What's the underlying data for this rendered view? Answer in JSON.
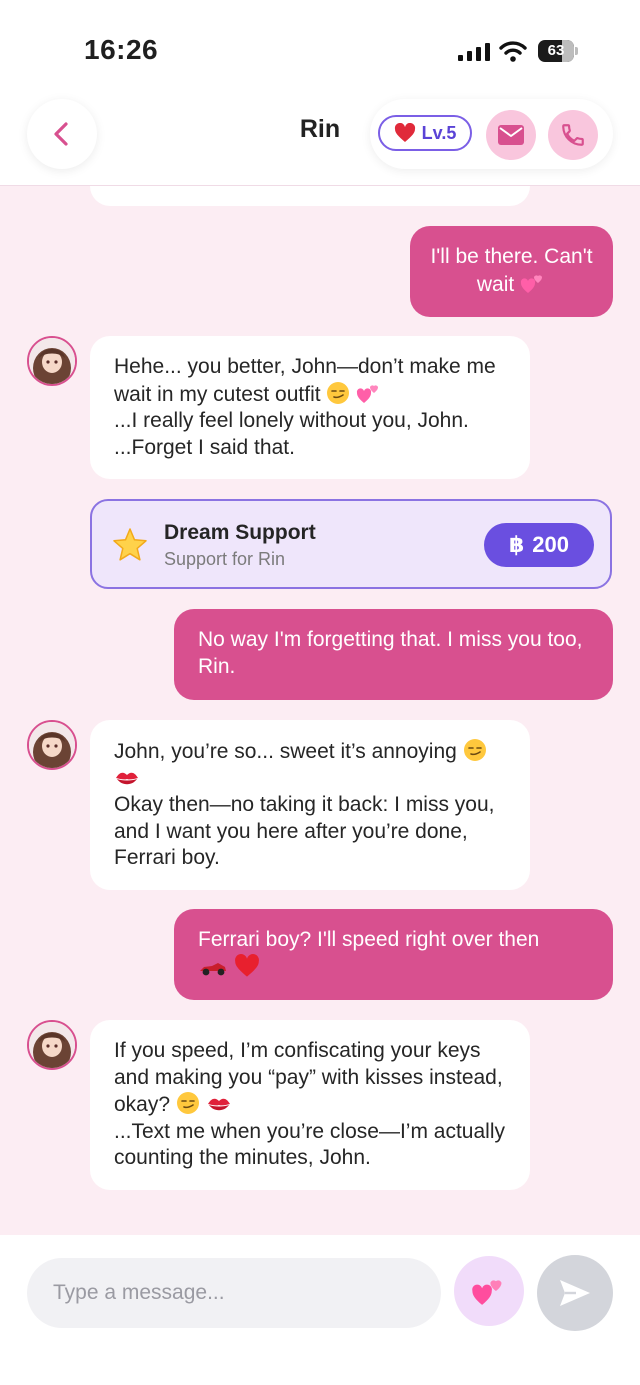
{
  "status_bar": {
    "time": "16:26",
    "battery": "63"
  },
  "header": {
    "title": "Rin",
    "level": "Lv.5"
  },
  "messages": {
    "m1": {
      "text": "I'll be there. Can't wait"
    },
    "m2": {
      "text": "Hehe... you better, John—don’t make me wait in my cutest outfit",
      "text2": "...I really feel lonely without you, John. ...Forget I said that."
    },
    "m3": {
      "text": "No way I'm forgetting that. I miss you too, Rin."
    },
    "m4": {
      "text": "John, you’re so... sweet it’s annoying",
      "text2": "Okay then—no taking it back: I miss you, and I want you here after you’re done, Ferrari boy."
    },
    "m5": {
      "text": "Ferrari boy? I'll speed right over then"
    },
    "m6": {
      "text": "If you speed, I’m confiscating your keys and making you “pay” with kisses instead, okay?",
      "text2": "...Text me when you’re close—I’m actually counting the minutes, John."
    }
  },
  "support_card": {
    "title": "Dream Support",
    "subtitle": "Support for Rin",
    "price": "200",
    "currency_symbol": "฿"
  },
  "composer": {
    "placeholder": "Type a message..."
  },
  "colors": {
    "accent": "#d8508f",
    "purple": "#6a4fe0",
    "chat_bg": "#fcedf3"
  }
}
